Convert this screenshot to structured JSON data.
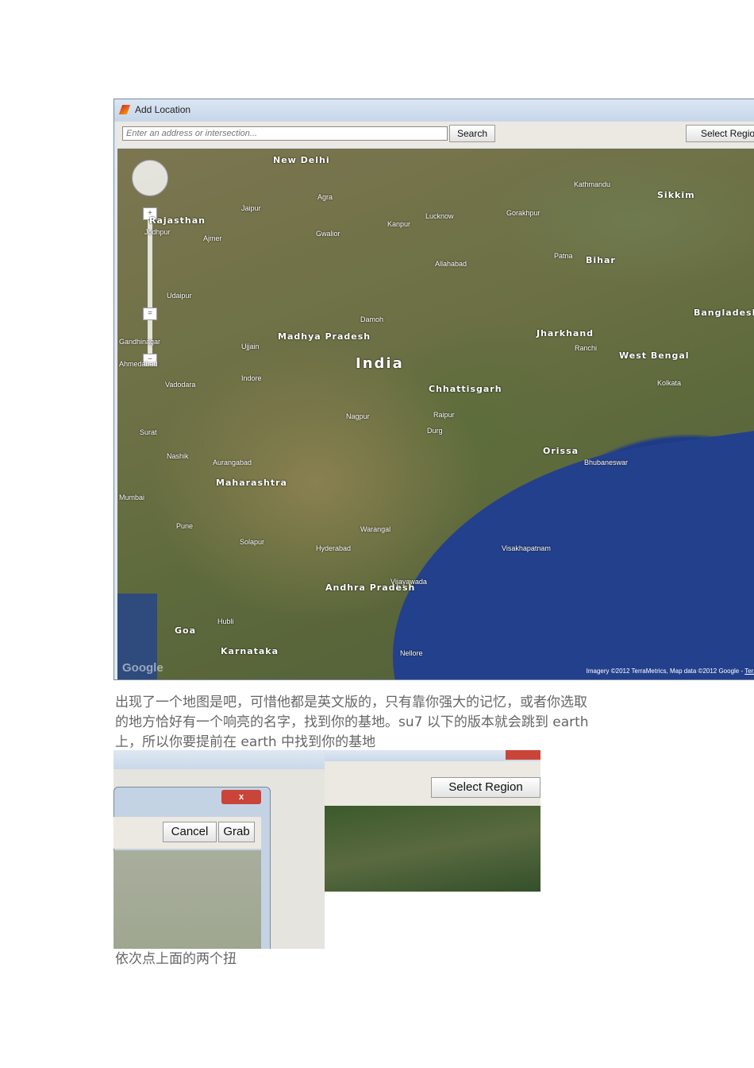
{
  "window": {
    "title": "Add Location",
    "address_placeholder": "Enter an address or intersection...",
    "search_label": "Search",
    "select_region_label": "Select Region"
  },
  "map": {
    "labels": [
      "New Delhi",
      "Agra",
      "Jaipur",
      "Rajasthan",
      "Jodhpur",
      "Ajmer",
      "Udaipur",
      "Gwalior",
      "Kanpur",
      "Lucknow",
      "Kathmandu",
      "Sikkim",
      "Patna",
      "Bihar",
      "Allahabad",
      "Madhya Pradesh",
      "Ujjain",
      "Indore",
      "India",
      "Jharkhand",
      "Ranchi",
      "West Bengal",
      "Kolkata",
      "Bangladesh",
      "Chhattisgarh",
      "Raipur",
      "Nagpur",
      "Vadodara",
      "Surat",
      "Nashik",
      "Aurangabad",
      "Maharashtra",
      "Mumbai",
      "Pune",
      "Orissa",
      "Bhubaneswar",
      "Hyderabad",
      "Warangal",
      "Visakhapatnam",
      "Andhra Pradesh",
      "Vijayawada",
      "Solapur",
      "Goa",
      "Hubli",
      "Karnataka",
      "Nellore",
      "Gandhinagar",
      "Ahmedabad",
      "Damoh",
      "Durg",
      "Gorakhpur"
    ],
    "attribution": "Imagery ©2012 TerraMetrics, Map data ©2012 Google - ",
    "terms": "Terms",
    "logo": "Google"
  },
  "text": {
    "para1": [
      "出现了一个地图是吧，可惜他都是英文版的，只有靠你强大的记忆，或者你选取",
      "的地方恰好有一个响亮的名字，找到你的基地。su7 以下的版本就会跳到 earth",
      "上，所以你要提前在 earth 中找到你的基地"
    ],
    "para2": "依次点上面的两个扭"
  },
  "dialog": {
    "cancel_label": "Cancel",
    "grab_label": "Grab",
    "select_region_label": "Select Region"
  }
}
